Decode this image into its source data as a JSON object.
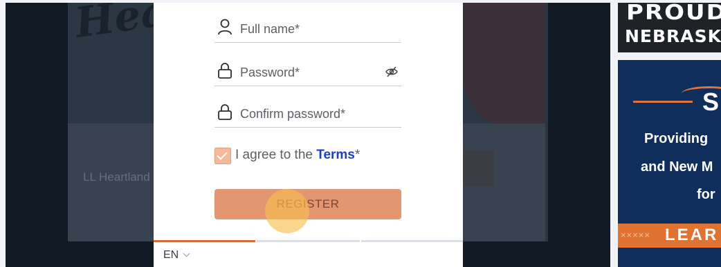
{
  "background_page": {
    "org_text": "LL Heartland"
  },
  "form": {
    "full_name_placeholder": "Full name*",
    "password_placeholder": "Password*",
    "confirm_password_placeholder": "Confirm password*",
    "agree_prefix": "I agree to the ",
    "terms_link": "Terms",
    "agree_suffix": "*",
    "agree_checked": true,
    "register_label": "REGISTER"
  },
  "progress": {
    "filled_fraction": 0.33
  },
  "language": {
    "selected": "EN"
  },
  "ads": {
    "banner_top_line1": "PROUD",
    "banner_top_line2": "NEBRASKA",
    "banner_side_letter": "S",
    "banner_side_line1": "Providing",
    "banner_side_line2": "and New M",
    "banner_side_line3": "for",
    "banner_side_marks": "×××××",
    "banner_side_cta": "LEAR"
  },
  "colors": {
    "accent": "#e29671",
    "progress": "#d76b3a",
    "terms_link": "#1d3fbf",
    "ad_navy": "#102e5c",
    "ad_orange": "#e07232"
  }
}
